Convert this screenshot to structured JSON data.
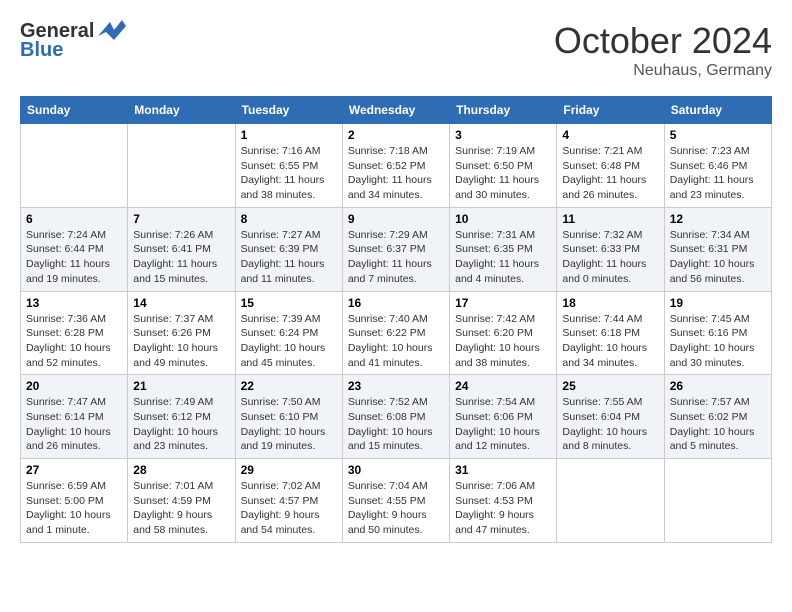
{
  "header": {
    "logo_general": "General",
    "logo_blue": "Blue",
    "month": "October 2024",
    "location": "Neuhaus, Germany"
  },
  "weekdays": [
    "Sunday",
    "Monday",
    "Tuesday",
    "Wednesday",
    "Thursday",
    "Friday",
    "Saturday"
  ],
  "weeks": [
    [
      {
        "day": "",
        "sunrise": "",
        "sunset": "",
        "daylight": ""
      },
      {
        "day": "",
        "sunrise": "",
        "sunset": "",
        "daylight": ""
      },
      {
        "day": "1",
        "sunrise": "Sunrise: 7:16 AM",
        "sunset": "Sunset: 6:55 PM",
        "daylight": "Daylight: 11 hours and 38 minutes."
      },
      {
        "day": "2",
        "sunrise": "Sunrise: 7:18 AM",
        "sunset": "Sunset: 6:52 PM",
        "daylight": "Daylight: 11 hours and 34 minutes."
      },
      {
        "day": "3",
        "sunrise": "Sunrise: 7:19 AM",
        "sunset": "Sunset: 6:50 PM",
        "daylight": "Daylight: 11 hours and 30 minutes."
      },
      {
        "day": "4",
        "sunrise": "Sunrise: 7:21 AM",
        "sunset": "Sunset: 6:48 PM",
        "daylight": "Daylight: 11 hours and 26 minutes."
      },
      {
        "day": "5",
        "sunrise": "Sunrise: 7:23 AM",
        "sunset": "Sunset: 6:46 PM",
        "daylight": "Daylight: 11 hours and 23 minutes."
      }
    ],
    [
      {
        "day": "6",
        "sunrise": "Sunrise: 7:24 AM",
        "sunset": "Sunset: 6:44 PM",
        "daylight": "Daylight: 11 hours and 19 minutes."
      },
      {
        "day": "7",
        "sunrise": "Sunrise: 7:26 AM",
        "sunset": "Sunset: 6:41 PM",
        "daylight": "Daylight: 11 hours and 15 minutes."
      },
      {
        "day": "8",
        "sunrise": "Sunrise: 7:27 AM",
        "sunset": "Sunset: 6:39 PM",
        "daylight": "Daylight: 11 hours and 11 minutes."
      },
      {
        "day": "9",
        "sunrise": "Sunrise: 7:29 AM",
        "sunset": "Sunset: 6:37 PM",
        "daylight": "Daylight: 11 hours and 7 minutes."
      },
      {
        "day": "10",
        "sunrise": "Sunrise: 7:31 AM",
        "sunset": "Sunset: 6:35 PM",
        "daylight": "Daylight: 11 hours and 4 minutes."
      },
      {
        "day": "11",
        "sunrise": "Sunrise: 7:32 AM",
        "sunset": "Sunset: 6:33 PM",
        "daylight": "Daylight: 11 hours and 0 minutes."
      },
      {
        "day": "12",
        "sunrise": "Sunrise: 7:34 AM",
        "sunset": "Sunset: 6:31 PM",
        "daylight": "Daylight: 10 hours and 56 minutes."
      }
    ],
    [
      {
        "day": "13",
        "sunrise": "Sunrise: 7:36 AM",
        "sunset": "Sunset: 6:28 PM",
        "daylight": "Daylight: 10 hours and 52 minutes."
      },
      {
        "day": "14",
        "sunrise": "Sunrise: 7:37 AM",
        "sunset": "Sunset: 6:26 PM",
        "daylight": "Daylight: 10 hours and 49 minutes."
      },
      {
        "day": "15",
        "sunrise": "Sunrise: 7:39 AM",
        "sunset": "Sunset: 6:24 PM",
        "daylight": "Daylight: 10 hours and 45 minutes."
      },
      {
        "day": "16",
        "sunrise": "Sunrise: 7:40 AM",
        "sunset": "Sunset: 6:22 PM",
        "daylight": "Daylight: 10 hours and 41 minutes."
      },
      {
        "day": "17",
        "sunrise": "Sunrise: 7:42 AM",
        "sunset": "Sunset: 6:20 PM",
        "daylight": "Daylight: 10 hours and 38 minutes."
      },
      {
        "day": "18",
        "sunrise": "Sunrise: 7:44 AM",
        "sunset": "Sunset: 6:18 PM",
        "daylight": "Daylight: 10 hours and 34 minutes."
      },
      {
        "day": "19",
        "sunrise": "Sunrise: 7:45 AM",
        "sunset": "Sunset: 6:16 PM",
        "daylight": "Daylight: 10 hours and 30 minutes."
      }
    ],
    [
      {
        "day": "20",
        "sunrise": "Sunrise: 7:47 AM",
        "sunset": "Sunset: 6:14 PM",
        "daylight": "Daylight: 10 hours and 26 minutes."
      },
      {
        "day": "21",
        "sunrise": "Sunrise: 7:49 AM",
        "sunset": "Sunset: 6:12 PM",
        "daylight": "Daylight: 10 hours and 23 minutes."
      },
      {
        "day": "22",
        "sunrise": "Sunrise: 7:50 AM",
        "sunset": "Sunset: 6:10 PM",
        "daylight": "Daylight: 10 hours and 19 minutes."
      },
      {
        "day": "23",
        "sunrise": "Sunrise: 7:52 AM",
        "sunset": "Sunset: 6:08 PM",
        "daylight": "Daylight: 10 hours and 15 minutes."
      },
      {
        "day": "24",
        "sunrise": "Sunrise: 7:54 AM",
        "sunset": "Sunset: 6:06 PM",
        "daylight": "Daylight: 10 hours and 12 minutes."
      },
      {
        "day": "25",
        "sunrise": "Sunrise: 7:55 AM",
        "sunset": "Sunset: 6:04 PM",
        "daylight": "Daylight: 10 hours and 8 minutes."
      },
      {
        "day": "26",
        "sunrise": "Sunrise: 7:57 AM",
        "sunset": "Sunset: 6:02 PM",
        "daylight": "Daylight: 10 hours and 5 minutes."
      }
    ],
    [
      {
        "day": "27",
        "sunrise": "Sunrise: 6:59 AM",
        "sunset": "Sunset: 5:00 PM",
        "daylight": "Daylight: 10 hours and 1 minute."
      },
      {
        "day": "28",
        "sunrise": "Sunrise: 7:01 AM",
        "sunset": "Sunset: 4:59 PM",
        "daylight": "Daylight: 9 hours and 58 minutes."
      },
      {
        "day": "29",
        "sunrise": "Sunrise: 7:02 AM",
        "sunset": "Sunset: 4:57 PM",
        "daylight": "Daylight: 9 hours and 54 minutes."
      },
      {
        "day": "30",
        "sunrise": "Sunrise: 7:04 AM",
        "sunset": "Sunset: 4:55 PM",
        "daylight": "Daylight: 9 hours and 50 minutes."
      },
      {
        "day": "31",
        "sunrise": "Sunrise: 7:06 AM",
        "sunset": "Sunset: 4:53 PM",
        "daylight": "Daylight: 9 hours and 47 minutes."
      },
      {
        "day": "",
        "sunrise": "",
        "sunset": "",
        "daylight": ""
      },
      {
        "day": "",
        "sunrise": "",
        "sunset": "",
        "daylight": ""
      }
    ]
  ]
}
